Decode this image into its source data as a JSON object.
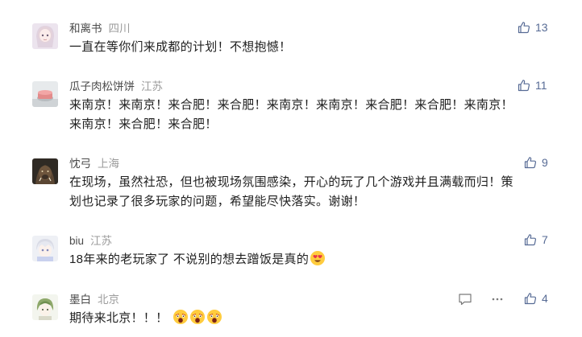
{
  "comments": [
    {
      "name": "和离书",
      "location": "四川",
      "text": "一直在等你们来成都的计划！不想抱憾！",
      "likes": "13",
      "avatar_icon": "anime-girl-avatar"
    },
    {
      "name": "瓜子肉松饼饼",
      "location": "江苏",
      "text": "来南京！来南京！来合肥！来合肥！来南京！来南京！来合肥！来合肥！来南京！",
      "text2": "来南京！来合肥！来合肥！",
      "likes": "11",
      "avatar_icon": "cake-avatar"
    },
    {
      "name": "忱弓",
      "location": "上海",
      "text": "在现场，虽然社恐，但也被现场氛围感染，开心的玩了几个游戏并且满载而归！策",
      "text2": "划也记录了很多玩家的问题，希望能尽快落实。谢谢！",
      "likes": "9",
      "avatar_icon": "boar-avatar"
    },
    {
      "name": "biu",
      "location": "江苏",
      "text": "18年来的老玩家了 不说别的想去蹭饭是真的",
      "likes": "7",
      "emoji": "heart-eyes-emoji",
      "avatar_icon": "anime-boy-avatar"
    },
    {
      "name": "墨白",
      "location": "北京",
      "text": "期待来北京！！！",
      "likes": "4",
      "emoji": "screaming-face-emoji",
      "avatar_icon": "green-hair-avatar"
    }
  ],
  "colors": {
    "name": "#4a4a4a",
    "location": "#9b9b9b",
    "likes": "#576b95",
    "text": "#1f1f1f"
  }
}
